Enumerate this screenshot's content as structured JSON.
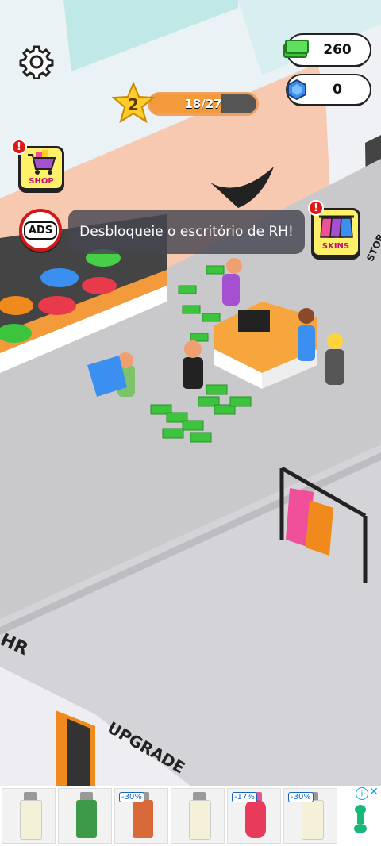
{
  "hud": {
    "cash": "260",
    "gems": "0",
    "level": "2",
    "progress_text": "18/27",
    "progress_fraction": 0.667
  },
  "buttons": {
    "shop_label": "SHOP",
    "skins_label": "SKINS",
    "ads_label": "ADS",
    "alert_mark": "!"
  },
  "message": "Desbloqueie o escritório de RH!",
  "floor": {
    "hr_label": "HR",
    "upgrade_label": "UPGRADE",
    "store_label": "STOR"
  },
  "ad_banner": {
    "discounts": [
      "-30%",
      "-17%",
      "-30%"
    ],
    "info_icon": "info-icon",
    "close_icon": "close-icon"
  },
  "colors": {
    "cash_green": "#3cc43c",
    "gem_blue": "#3a8ff0",
    "progress_orange": "#f39a3b",
    "alert_red": "#e01818",
    "button_yellow": "#fff06a"
  }
}
